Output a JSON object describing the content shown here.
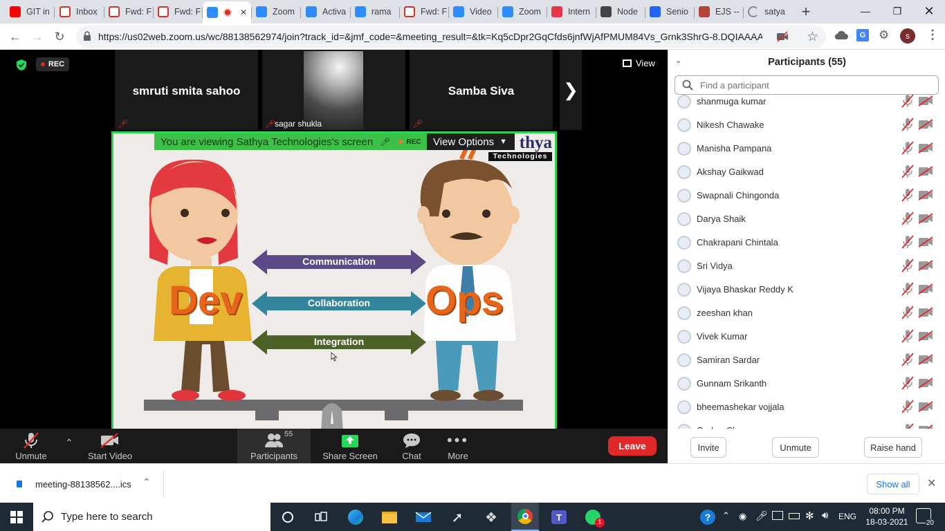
{
  "browser": {
    "tabs": [
      {
        "label": "GIT in",
        "icon": "youtube-icon",
        "color": "#ff0000"
      },
      {
        "label": "Inbox",
        "icon": "gmail-icon",
        "color": "#d93025"
      },
      {
        "label": "Fwd: F",
        "icon": "gmail-icon",
        "color": "#d93025"
      },
      {
        "label": "Fwd: F",
        "icon": "gmail-icon",
        "color": "#d93025"
      },
      {
        "label": "",
        "icon": "zoom-icon",
        "color": "#2d8cff",
        "active": true
      },
      {
        "label": "Zoom",
        "icon": "zoom-icon",
        "color": "#2d8cff"
      },
      {
        "label": "Activa",
        "icon": "zoom-icon",
        "color": "#2d8cff"
      },
      {
        "label": "rama",
        "icon": "zoom-icon",
        "color": "#2d8cff"
      },
      {
        "label": "Fwd: F",
        "icon": "gmail-icon",
        "color": "#d93025"
      },
      {
        "label": "Video",
        "icon": "zoom-icon",
        "color": "#2d8cff"
      },
      {
        "label": "Zoom",
        "icon": "zoom-icon",
        "color": "#2d8cff"
      },
      {
        "label": "Intern",
        "icon": "r-icon",
        "color": "#e8344e"
      },
      {
        "label": "Node",
        "icon": "node-icon",
        "color": "#444"
      },
      {
        "label": "Senio",
        "icon": "indeed-icon",
        "color": "#2164f3"
      },
      {
        "label": "EJS --",
        "icon": "ejs-icon",
        "color": "#b4433e"
      },
      {
        "label": "satya",
        "icon": "loading-icon",
        "color": "#888"
      }
    ],
    "url": "https://us02web.zoom.us/wc/88138562974/join?track_id=&jmf_code=&meeting_result=&tk=Kq5cDpr2GqCfds6jnfWjAfPMUM84Vs_Grnk3ShrG-8.DQIAAAA...",
    "profile_initial": "s"
  },
  "meeting": {
    "rec_label": "REC",
    "view_label": "View",
    "thumbnails": [
      {
        "name": "smruti smita sahoo"
      },
      {
        "name": "sagar shukla"
      },
      {
        "name": "Samba Siva"
      }
    ],
    "share_banner": "You are viewing Sathya Technologies's screen",
    "share_rec": "REC",
    "view_options": "View Options",
    "slide": {
      "brand": "thya",
      "brand_sub": "Technologies",
      "left_word": "Dev",
      "right_word": "Ops",
      "arrows": [
        "Communication",
        "Collaboration",
        "Integration"
      ]
    }
  },
  "controls": {
    "unmute": "Unmute",
    "start_video": "Start Video",
    "participants": "Participants",
    "participants_count": "55",
    "share_screen": "Share Screen",
    "chat": "Chat",
    "more": "More",
    "leave": "Leave"
  },
  "participants_panel": {
    "title": "Participants (55)",
    "search_placeholder": "Find a participant",
    "people": [
      "shanmuga kumar",
      "Nikesh Chawake",
      "Manisha Pampana",
      "Akshay Gaikwad",
      "Swapnali Chingonda",
      "Darya Shaik",
      "Chakrapani Chintala",
      "Sri Vidya",
      "Vijaya Bhaskar Reddy K",
      "zeeshan khan",
      "Vivek Kumar",
      "Samiran Sardar",
      "Gunnam Srikanth",
      "bheemashekar vojjala",
      "Omkar Chavan"
    ],
    "invite": "Invite",
    "unmute": "Unmute",
    "raise_hand": "Raise hand"
  },
  "download": {
    "file": "meeting-88138562....ics",
    "show_all": "Show all"
  },
  "taskbar": {
    "search_placeholder": "Type here to search",
    "language": "ENG",
    "time": "08:00 PM",
    "date": "18-03-2021",
    "notif_count": "20",
    "whatsapp_badge": "1"
  }
}
